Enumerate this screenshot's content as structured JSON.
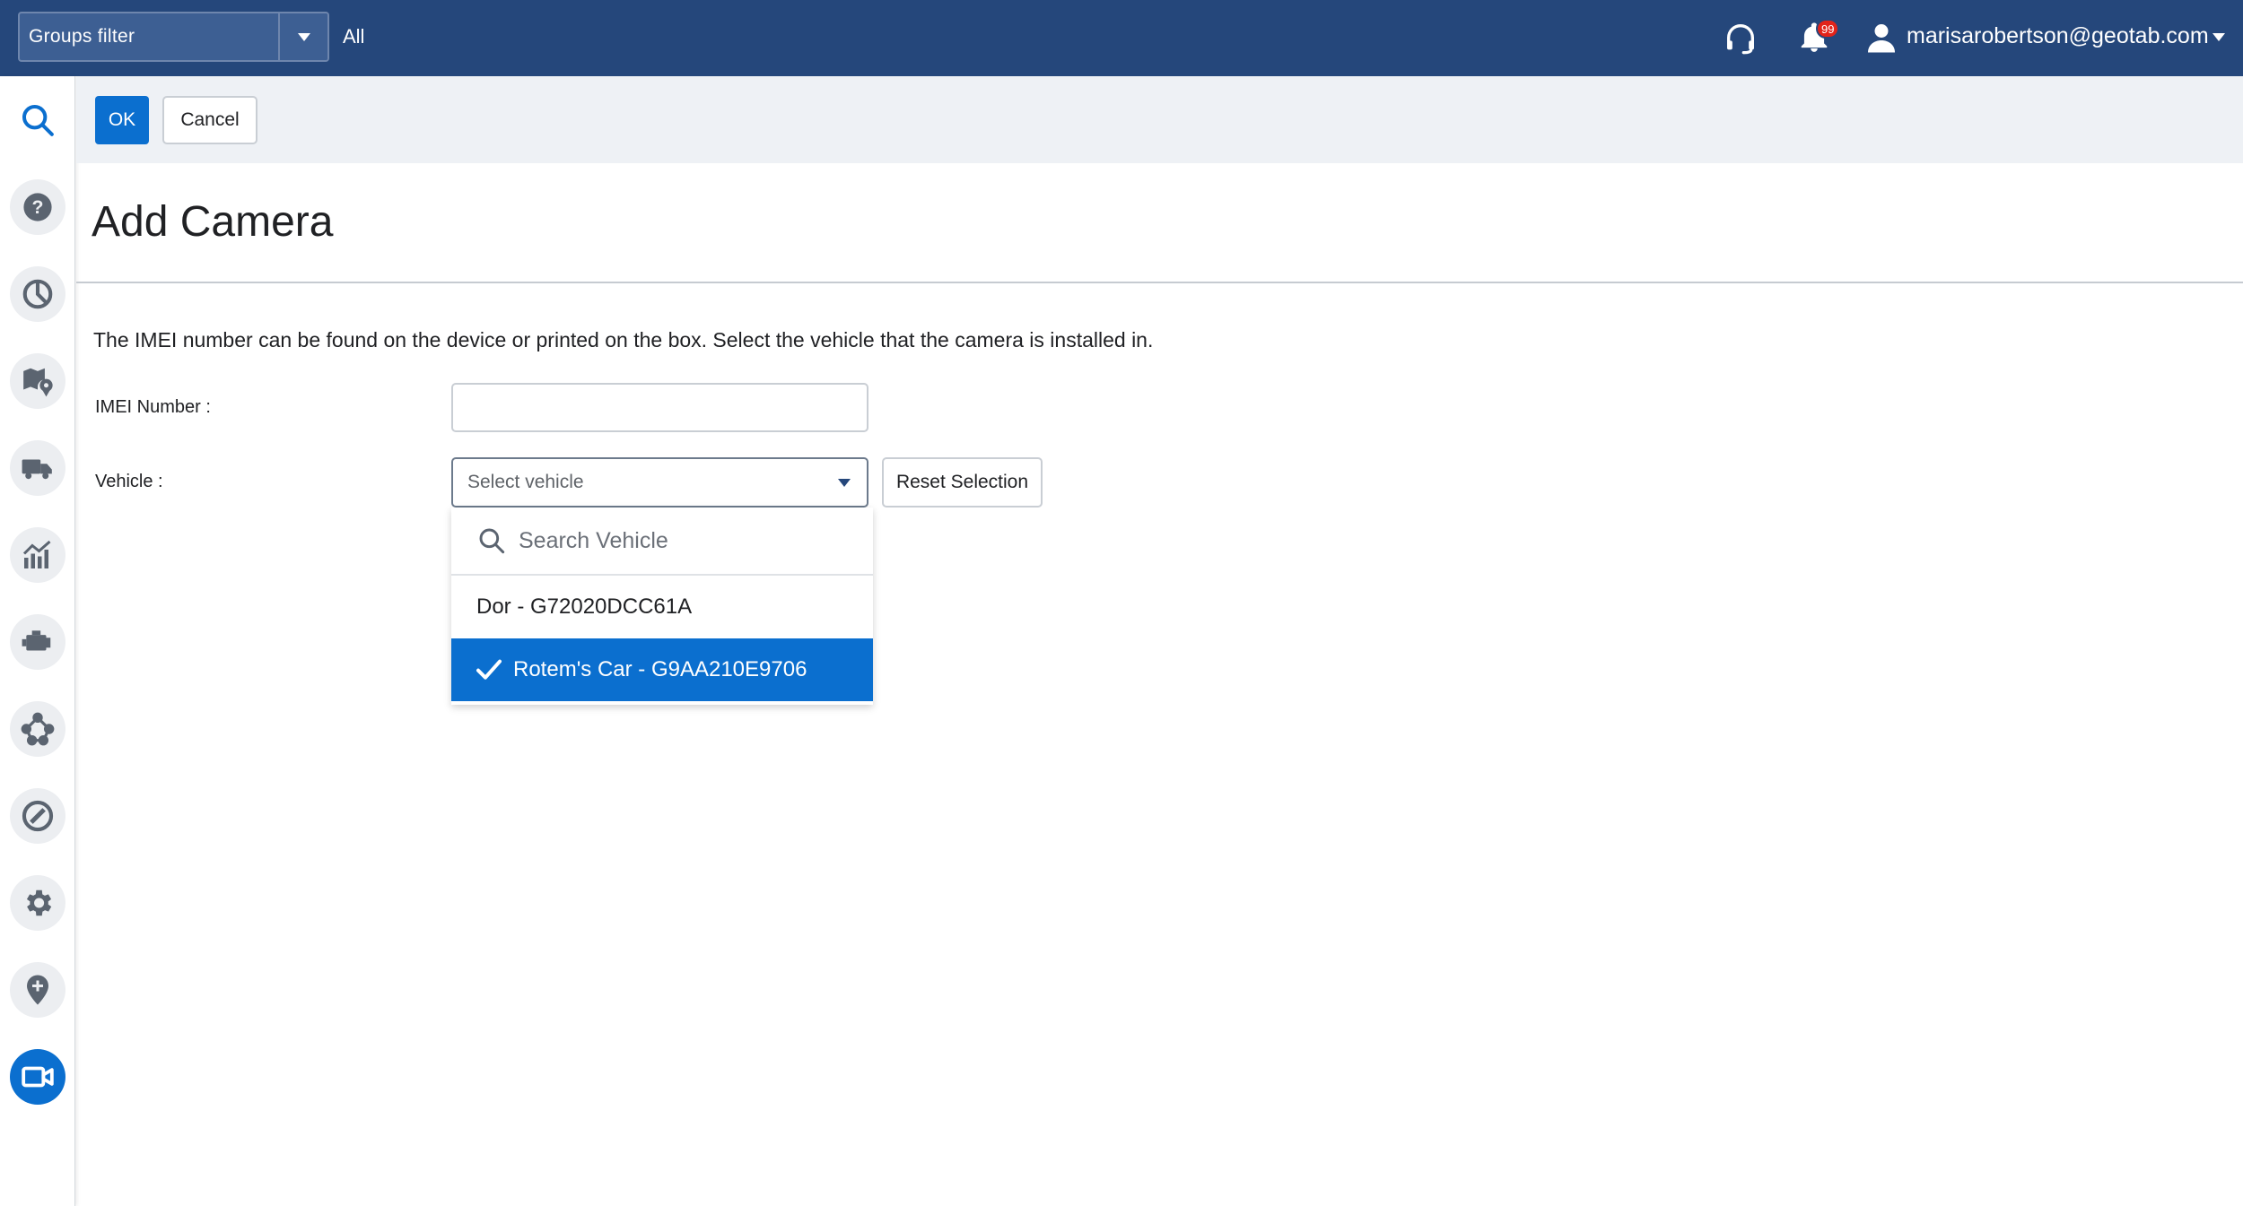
{
  "header": {
    "groups_filter_label": "Groups filter",
    "groups_filter_value": "All",
    "notification_count": "99",
    "user_email": "marisarobertson@geotab.com",
    "background_color": "#25477b"
  },
  "sidebar": {
    "items": [
      {
        "icon": "search-icon"
      },
      {
        "icon": "help-icon"
      },
      {
        "icon": "dashboard-icon"
      },
      {
        "icon": "map-icon"
      },
      {
        "icon": "vehicle-truck-icon"
      },
      {
        "icon": "activity-chart-icon"
      },
      {
        "icon": "engine-icon"
      },
      {
        "icon": "rules-icon"
      },
      {
        "icon": "exceptions-icon"
      },
      {
        "icon": "settings-gear-icon"
      },
      {
        "icon": "location-pin-icon"
      },
      {
        "icon": "camera-icon",
        "active": true
      }
    ],
    "active_color": "#0b6fcf"
  },
  "toolbar": {
    "ok_label": "OK",
    "cancel_label": "Cancel"
  },
  "page": {
    "title": "Add Camera",
    "description": "The IMEI number can be found on the device or printed on the box. Select the vehicle that the camera is installed in.",
    "imei_label": "IMEI Number :",
    "imei_value": "",
    "vehicle_label": "Vehicle :",
    "vehicle_placeholder": "Select vehicle",
    "reset_label": "Reset Selection"
  },
  "vehicle_dropdown": {
    "search_placeholder": "Search Vehicle",
    "options": [
      {
        "label": "Dor - G72020DCC61A",
        "selected": false
      },
      {
        "label": "Rotem's Car - G9AA210E9706",
        "selected": true
      }
    ],
    "selected_color": "#0b6fcf"
  }
}
